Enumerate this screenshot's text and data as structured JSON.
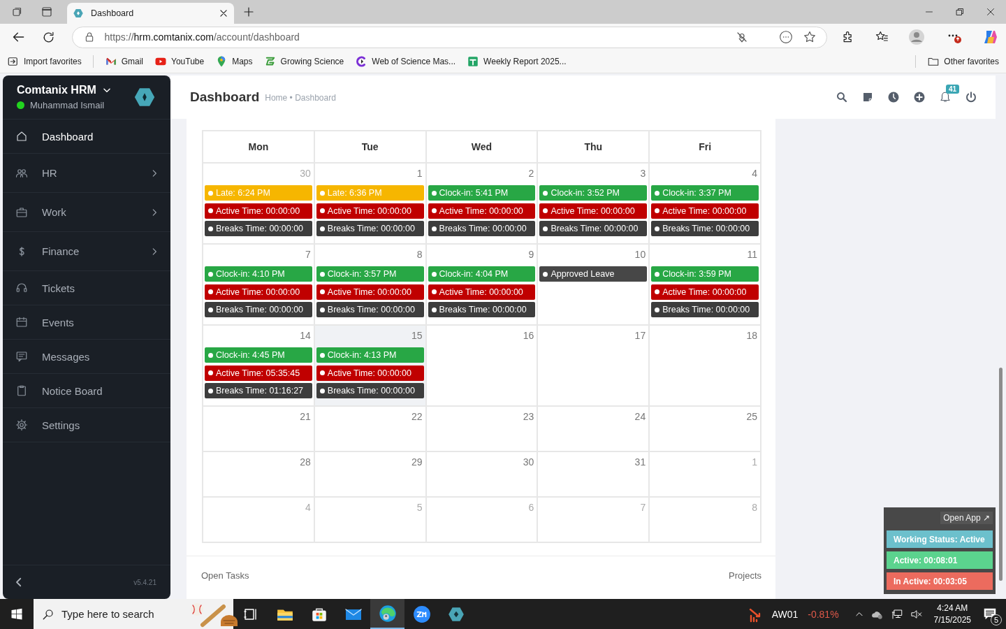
{
  "browser": {
    "tabs": [
      {
        "title": "Dashboard",
        "selected": true
      }
    ],
    "url": {
      "scheme": "https://",
      "host": "hrm.comtanix.com",
      "path": "/account/dashboard"
    },
    "favorites": [
      {
        "label": "Import favorites"
      },
      {
        "label": "Gmail"
      },
      {
        "label": "YouTube"
      },
      {
        "label": "Maps"
      },
      {
        "label": "Growing Science"
      },
      {
        "label": "Web of Science Mas..."
      },
      {
        "label": "Weekly Report 2025..."
      }
    ],
    "other_favorites": "Other favorites"
  },
  "sidebar": {
    "app_name": "Comtanix HRM",
    "user": "Muhammad Ismail",
    "online": true,
    "items": [
      {
        "label": "Dashboard",
        "selected": true,
        "expandable": false
      },
      {
        "label": "HR",
        "selected": false,
        "expandable": true
      },
      {
        "label": "Work",
        "selected": false,
        "expandable": true
      },
      {
        "label": "Finance",
        "selected": false,
        "expandable": true
      },
      {
        "label": "Tickets",
        "selected": false,
        "expandable": false
      },
      {
        "label": "Events",
        "selected": false,
        "expandable": false
      },
      {
        "label": "Messages",
        "selected": false,
        "expandable": false
      },
      {
        "label": "Notice Board",
        "selected": false,
        "expandable": false
      },
      {
        "label": "Settings",
        "selected": false,
        "expandable": false
      }
    ],
    "version": "v5.4.21"
  },
  "header": {
    "title": "Dashboard",
    "breadcrumb": "Home • Dashboard",
    "notification_count": "41"
  },
  "calendar": {
    "weekdays": [
      "Mon",
      "Tue",
      "Wed",
      "Thu",
      "Fri"
    ],
    "weeks": [
      [
        {
          "day": "30",
          "muted": true,
          "today": false,
          "events": [
            {
              "kind": "late",
              "text": "Late: 6:24 PM"
            },
            {
              "kind": "active",
              "text": "Active Time: 00:00:00"
            },
            {
              "kind": "breaks",
              "text": "Breaks Time: 00:00:00"
            }
          ]
        },
        {
          "day": "1",
          "muted": false,
          "today": false,
          "events": [
            {
              "kind": "late",
              "text": "Late: 6:36 PM"
            },
            {
              "kind": "active",
              "text": "Active Time: 00:00:00"
            },
            {
              "kind": "breaks",
              "text": "Breaks Time: 00:00:00"
            }
          ]
        },
        {
          "day": "2",
          "muted": false,
          "today": false,
          "events": [
            {
              "kind": "clockin",
              "text": "Clock-in: 5:41 PM"
            },
            {
              "kind": "active",
              "text": "Active Time: 00:00:00"
            },
            {
              "kind": "breaks",
              "text": "Breaks Time: 00:00:00"
            }
          ]
        },
        {
          "day": "3",
          "muted": false,
          "today": false,
          "events": [
            {
              "kind": "clockin",
              "text": "Clock-in: 3:52 PM"
            },
            {
              "kind": "active",
              "text": "Active Time: 00:00:00"
            },
            {
              "kind": "breaks",
              "text": "Breaks Time: 00:00:00"
            }
          ]
        },
        {
          "day": "4",
          "muted": false,
          "today": false,
          "events": [
            {
              "kind": "clockin",
              "text": "Clock-in: 3:37 PM"
            },
            {
              "kind": "active",
              "text": "Active Time: 00:00:00"
            },
            {
              "kind": "breaks",
              "text": "Breaks Time: 00:00:00"
            }
          ]
        }
      ],
      [
        {
          "day": "7",
          "muted": false,
          "today": false,
          "events": [
            {
              "kind": "clockin",
              "text": "Clock-in: 4:10 PM"
            },
            {
              "kind": "active",
              "text": "Active Time: 00:00:00"
            },
            {
              "kind": "breaks",
              "text": "Breaks Time: 00:00:00"
            }
          ]
        },
        {
          "day": "8",
          "muted": false,
          "today": false,
          "events": [
            {
              "kind": "clockin",
              "text": "Clock-in: 3:57 PM"
            },
            {
              "kind": "active",
              "text": "Active Time: 00:00:00"
            },
            {
              "kind": "breaks",
              "text": "Breaks Time: 00:00:00"
            }
          ]
        },
        {
          "day": "9",
          "muted": false,
          "today": false,
          "events": [
            {
              "kind": "clockin",
              "text": "Clock-in: 4:04 PM"
            },
            {
              "kind": "active",
              "text": "Active Time: 00:00:00"
            },
            {
              "kind": "breaks",
              "text": "Breaks Time: 00:00:00"
            }
          ]
        },
        {
          "day": "10",
          "muted": false,
          "today": false,
          "events": [
            {
              "kind": "leave",
              "text": "Approved Leave"
            }
          ]
        },
        {
          "day": "11",
          "muted": false,
          "today": false,
          "events": [
            {
              "kind": "clockin",
              "text": "Clock-in: 3:59 PM"
            },
            {
              "kind": "active",
              "text": "Active Time: 00:00:00"
            },
            {
              "kind": "breaks",
              "text": "Breaks Time: 00:00:00"
            }
          ]
        }
      ],
      [
        {
          "day": "14",
          "muted": false,
          "today": false,
          "events": [
            {
              "kind": "clockin",
              "text": "Clock-in: 4:45 PM"
            },
            {
              "kind": "active",
              "text": "Active Time: 05:35:45"
            },
            {
              "kind": "breaks",
              "text": "Breaks Time: 01:16:27"
            }
          ]
        },
        {
          "day": "15",
          "muted": false,
          "today": true,
          "events": [
            {
              "kind": "clockin",
              "text": "Clock-in: 4:13 PM"
            },
            {
              "kind": "active",
              "text": "Active Time: 00:00:00"
            },
            {
              "kind": "breaks",
              "text": "Breaks Time: 00:00:00"
            }
          ]
        },
        {
          "day": "16",
          "muted": false,
          "today": false
        },
        {
          "day": "17",
          "muted": false,
          "today": false
        },
        {
          "day": "18",
          "muted": false,
          "today": false
        }
      ],
      [
        {
          "day": "21",
          "muted": false,
          "today": false
        },
        {
          "day": "22",
          "muted": false,
          "today": false
        },
        {
          "day": "23",
          "muted": false,
          "today": false
        },
        {
          "day": "24",
          "muted": false,
          "today": false
        },
        {
          "day": "25",
          "muted": false,
          "today": false
        }
      ],
      [
        {
          "day": "28",
          "muted": false,
          "today": false
        },
        {
          "day": "29",
          "muted": false,
          "today": false
        },
        {
          "day": "30",
          "muted": false,
          "today": false
        },
        {
          "day": "31",
          "muted": false,
          "today": false
        },
        {
          "day": "1",
          "muted": true,
          "today": false
        }
      ],
      [
        {
          "day": "4",
          "muted": true,
          "today": false
        },
        {
          "day": "5",
          "muted": true,
          "today": false
        },
        {
          "day": "6",
          "muted": true,
          "today": false
        },
        {
          "day": "7",
          "muted": true,
          "today": false
        },
        {
          "day": "8",
          "muted": true,
          "today": false
        }
      ]
    ]
  },
  "lower_panel": {
    "left_title": "Open Tasks",
    "right_title": "Projects"
  },
  "widget": {
    "open_app": "Open App ↗",
    "rows": [
      {
        "kind": "status",
        "text": "Working Status: Active"
      },
      {
        "kind": "active",
        "text": "Active: 00:08:01"
      },
      {
        "kind": "inactive",
        "text": "In Active: 00:03:05"
      }
    ]
  },
  "taskbar": {
    "search_placeholder": "Type here to search",
    "apps": [
      {
        "selected": false
      },
      {
        "selected": false
      },
      {
        "selected": false
      },
      {
        "selected": false
      },
      {
        "selected": true
      },
      {
        "selected": false
      },
      {
        "selected": false
      }
    ],
    "ticker": "AW01",
    "change": "-0.81%",
    "time": "4:24 AM",
    "date": "7/15/2025",
    "notifications": "5"
  }
}
